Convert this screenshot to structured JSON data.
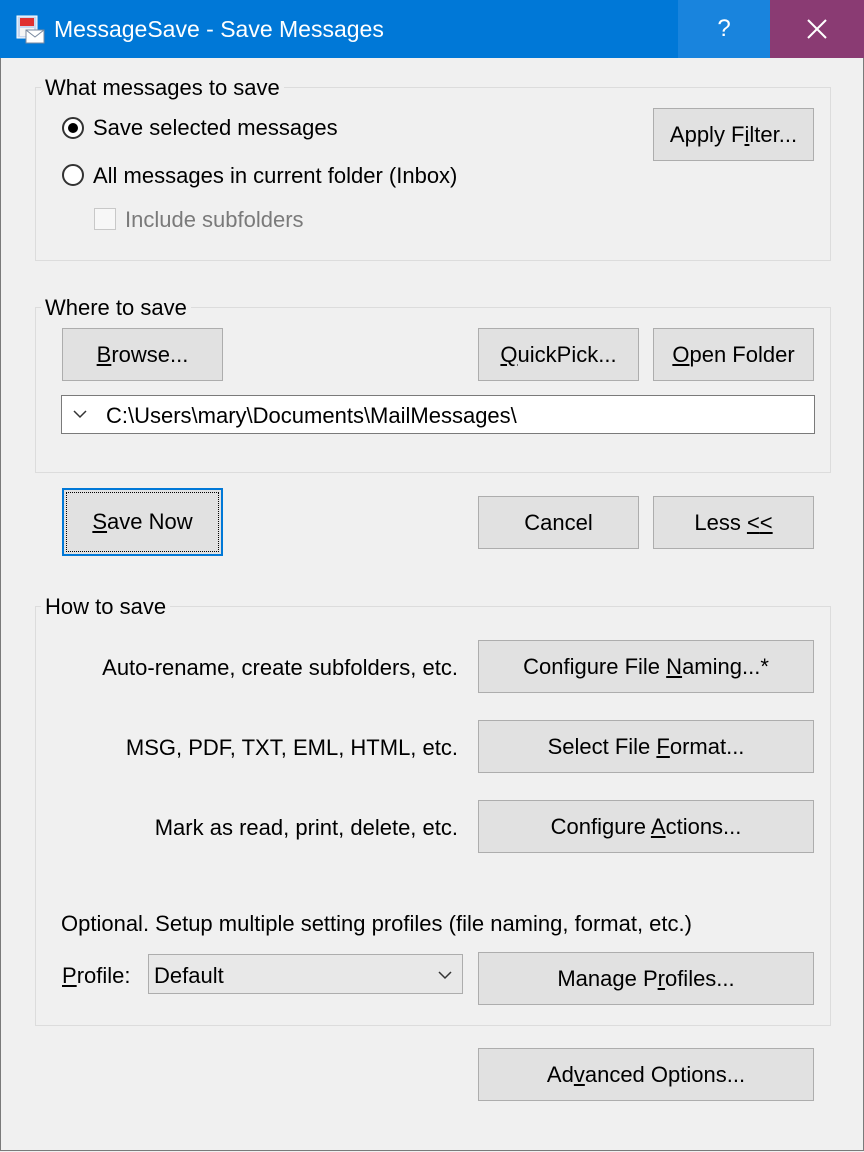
{
  "window": {
    "title": "MessageSave - Save Messages",
    "help_glyph": "?",
    "icon": "messagesave-app-icon"
  },
  "what_to_save": {
    "group_label": "What messages to save",
    "radio_selected_label": "Save selected messages",
    "radio_all_label": "All messages in current folder (Inbox)",
    "selected_option": "Save selected messages",
    "include_subfolders_label": "Include subfolders",
    "include_subfolders_checked": false,
    "apply_filter": {
      "pre": "Apply F",
      "key": "i",
      "post": "lter..."
    }
  },
  "where_to_save": {
    "group_label": "Where to save",
    "browse": {
      "pre": "",
      "key": "B",
      "post": "rowse..."
    },
    "quickpick": {
      "pre": "",
      "key": "Q",
      "post": "uickPick..."
    },
    "open_folder": {
      "pre": "",
      "key": "O",
      "post": "pen Folder"
    },
    "path_value": "C:\\Users\\mary\\Documents\\MailMessages\\"
  },
  "actions": {
    "save_now": {
      "pre": "",
      "key": "S",
      "post": "ave Now"
    },
    "cancel_label": "Cancel",
    "less": {
      "pre": "Less ",
      "key": "<",
      "post": "<"
    }
  },
  "how_to_save": {
    "group_label": "How to save",
    "rows": [
      {
        "description": "Auto-rename, create subfolders, etc.",
        "btn": {
          "pre": "Configure File ",
          "key": "N",
          "post": "aming...*"
        }
      },
      {
        "description": "MSG, PDF, TXT, EML, HTML, etc.",
        "btn": {
          "pre": "Select File ",
          "key": "F",
          "post": "ormat..."
        }
      },
      {
        "description": "Mark as read, print, delete, etc.",
        "btn": {
          "pre": "Configure ",
          "key": "A",
          "post": "ctions..."
        }
      }
    ],
    "profiles_note": "Optional. Setup multiple setting profiles (file naming, format, etc.)",
    "profile_label": {
      "pre": "",
      "key": "P",
      "post": "rofile:"
    },
    "profile_value": "Default",
    "manage_profiles": {
      "pre": "Manage P",
      "key": "r",
      "post": "ofiles..."
    }
  },
  "advanced": {
    "pre": "Ad",
    "key": "v",
    "post": "anced Options..."
  }
}
